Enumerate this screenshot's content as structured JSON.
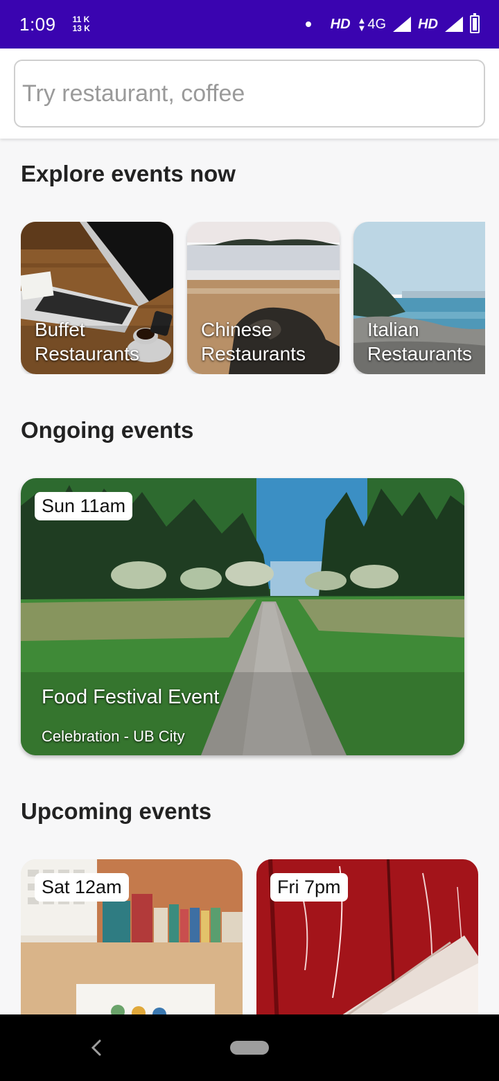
{
  "status_bar": {
    "time": "1:09",
    "speed_up": "11 K",
    "speed_down": "13 K",
    "hd1": "HD",
    "network": "4G",
    "hd2": "HD"
  },
  "search": {
    "placeholder": "Try restaurant, coffee"
  },
  "sections": {
    "explore_title": "Explore events now",
    "ongoing_title": "Ongoing events",
    "upcoming_title": "Upcoming events"
  },
  "categories": [
    {
      "label": "Buffet Restaurants"
    },
    {
      "label": "Chinese Restaurants"
    },
    {
      "label": "Italian Restaurants"
    }
  ],
  "ongoing": [
    {
      "time": "Sun 11am",
      "title": "Food Festival Event",
      "subtitle": "Celebration - UB City"
    }
  ],
  "upcoming": [
    {
      "time": "Sat 12am"
    },
    {
      "time": "Fri 7pm"
    }
  ],
  "colors": {
    "status_bar": "#3a04b0",
    "background": "#f7f7f8"
  }
}
